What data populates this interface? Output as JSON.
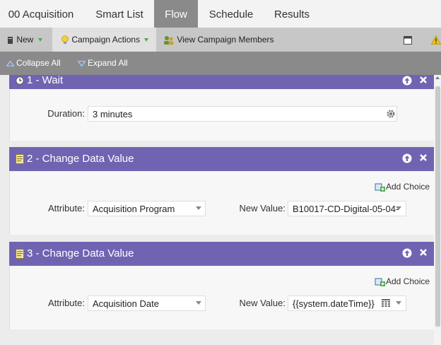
{
  "tabs": [
    {
      "label": "00 Acquisition"
    },
    {
      "label": "Smart List"
    },
    {
      "label": "Flow",
      "active": true
    },
    {
      "label": "Schedule"
    },
    {
      "label": "Results"
    }
  ],
  "toolbar": {
    "new_label": "New",
    "campaign_actions_label": "Campaign Actions",
    "view_members_label": "View Campaign Members"
  },
  "subtoolbar": {
    "collapse_all_label": "Collapse All",
    "expand_all_label": "Expand All"
  },
  "steps": [
    {
      "title": "1 - Wait",
      "icon": "clock-icon",
      "duration_label": "Duration:",
      "duration_value": "3 minutes"
    },
    {
      "title": "2 - Change Data Value",
      "icon": "data-value-icon",
      "add_choice_label": "Add Choice",
      "attribute_label": "Attribute:",
      "attribute_value": "Acquisition Program",
      "new_value_label": "New Value:",
      "new_value": "B10017-CD-Digital-05-04-"
    },
    {
      "title": "3 - Change Data Value",
      "icon": "data-value-icon",
      "add_choice_label": "Add Choice",
      "attribute_label": "Attribute:",
      "attribute_value": "Acquisition Date",
      "new_value_label": "New Value:",
      "new_value": "{{system.dateTime}}"
    }
  ],
  "colors": {
    "step_header": "#7064b2",
    "active_tab": "#8a8a8a",
    "toolbar": "#c7c7c7"
  }
}
